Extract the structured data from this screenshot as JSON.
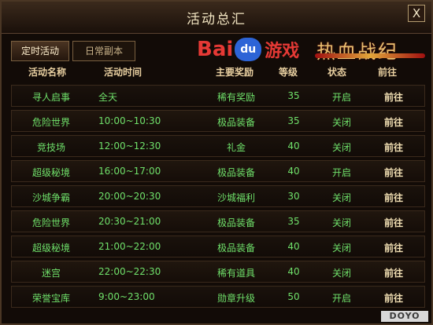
{
  "window": {
    "title": "活动总汇",
    "close_label": "X"
  },
  "tabs": [
    {
      "label": "定时活动",
      "active": true
    },
    {
      "label": "日常副本",
      "active": false
    }
  ],
  "branding": {
    "baidu_text": "Bai",
    "baidu_paw": "du",
    "baidu_game": "游戏",
    "game_logo": "热血战纪"
  },
  "table": {
    "headers": {
      "name": "活动名称",
      "time": "活动时间",
      "reward": "主要奖励",
      "level": "等级",
      "status": "状态",
      "go": "前往"
    },
    "rows": [
      {
        "name": "寻人启事",
        "time": "全天",
        "reward": "稀有奖励",
        "level": "35",
        "status": "开启",
        "go": "前往"
      },
      {
        "name": "危险世界",
        "time": "10:00~10:30",
        "reward": "极品装备",
        "level": "35",
        "status": "关闭",
        "go": "前往"
      },
      {
        "name": "竞技场",
        "time": "12:00~12:30",
        "reward": "礼金",
        "level": "40",
        "status": "关闭",
        "go": "前往"
      },
      {
        "name": "超级秘境",
        "time": "16:00~17:00",
        "reward": "极品装备",
        "level": "40",
        "status": "开启",
        "go": "前往"
      },
      {
        "name": "沙城争霸",
        "time": "20:00~20:30",
        "reward": "沙城福利",
        "level": "30",
        "status": "关闭",
        "go": "前往"
      },
      {
        "name": "危险世界",
        "time": "20:30~21:00",
        "reward": "极品装备",
        "level": "35",
        "status": "关闭",
        "go": "前往"
      },
      {
        "name": "超级秘境",
        "time": "21:00~22:00",
        "reward": "极品装备",
        "level": "40",
        "status": "关闭",
        "go": "前往"
      },
      {
        "name": "迷宫",
        "time": "22:00~22:30",
        "reward": "稀有道具",
        "level": "40",
        "status": "关闭",
        "go": "前往"
      },
      {
        "name": "荣誉宝库",
        "time": "9:00~23:00",
        "reward": "勋章升级",
        "level": "50",
        "status": "开启",
        "go": "前往"
      }
    ]
  },
  "watermark": "DOYO",
  "colors": {
    "value_text": "#6fe06a",
    "header_text": "#e8cfa0",
    "go_text": "#f2e0b4",
    "background": "#120b07",
    "border": "#4a3624"
  }
}
